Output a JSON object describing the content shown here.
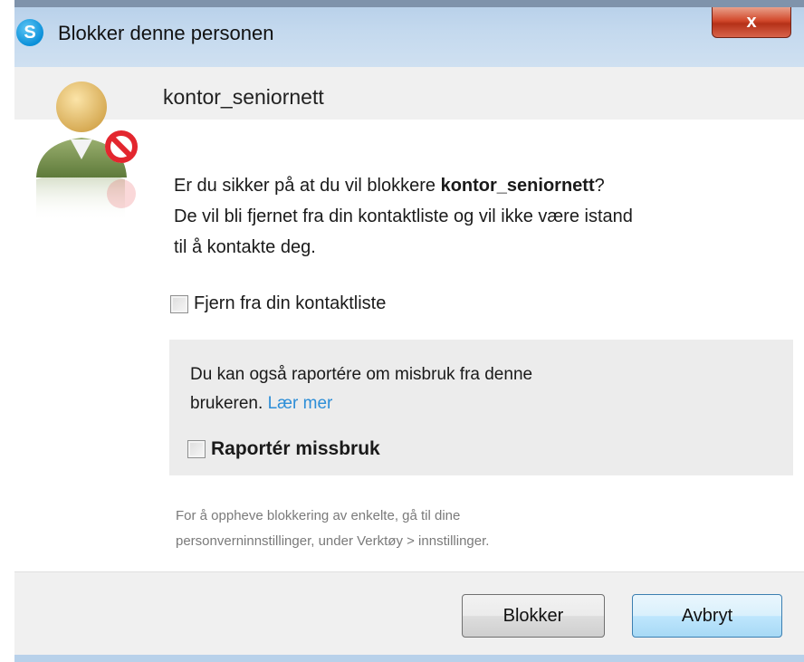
{
  "window": {
    "title": "Blokker denne personen",
    "close_label": "x",
    "app_icon_letter": "S"
  },
  "contact": {
    "name": "kontor_seniornett"
  },
  "dialog": {
    "question_prefix": "Er du sikker på at du vil blokkere ",
    "question_name": "kontor_seniornett",
    "question_suffix": "?",
    "question_line2": "De vil bli fjernet fra din kontaktliste og vil ikke være istand",
    "question_line3": "til å kontakte deg.",
    "remove_checkbox_label": "Fjern fra din kontaktliste",
    "remove_checked": false,
    "report_text_1": "Du kan også raportére om misbruk fra denne",
    "report_text_2": "brukeren.",
    "learn_more_link": "Lær mer",
    "report_checkbox_label": "Raportér missbruk",
    "report_checked": false,
    "footnote_line1": "For å oppheve blokkering av enkelte, gå til dine",
    "footnote_line2": "personverninnstillinger, under Verktøy > innstillinger."
  },
  "buttons": {
    "block": "Blokker",
    "cancel": "Avbryt"
  },
  "colors": {
    "link": "#2d8ed7",
    "titlebar": "#c4d9ee",
    "close": "#c8402a",
    "block_sign": "#e3262e"
  },
  "icons": {
    "app": "skype-icon",
    "avatar": "blocked-user-icon"
  }
}
